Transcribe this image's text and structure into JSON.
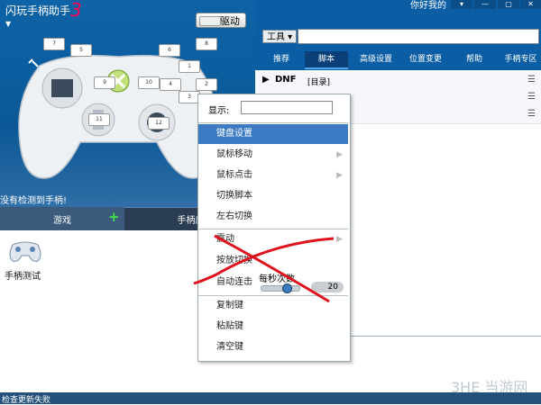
{
  "app": {
    "title": "闪玩手柄助手",
    "user": "你好我的",
    "driver_label": "驱动",
    "status_line": "没有检测到手柄!",
    "bottom_status": "检查更新失败"
  },
  "window_controls": [
    "▾",
    "—",
    "▢",
    "✕"
  ],
  "toolbar": {
    "tool_label": "工具"
  },
  "nav_tabs": [
    "推荐",
    "脚本",
    "高级设置",
    "位置变更",
    "帮助",
    "手柄专区"
  ],
  "active_tab": 1,
  "controller_buttons": [
    "7",
    "5",
    "6",
    "8",
    "1",
    "9",
    "10",
    "4",
    "2",
    "3",
    "11",
    "12"
  ],
  "left_tabs": {
    "games": "游戏",
    "apps": "手柄应"
  },
  "games": [
    {
      "label": "手柄测试",
      "icon": "gamepad-icon"
    }
  ],
  "scripts": [
    {
      "name": "DNF",
      "tag": "[目录]"
    },
    {
      "name": "",
      "tag": ""
    },
    {
      "name": "",
      "tag": ""
    }
  ],
  "context_menu": {
    "display_label": "显示:",
    "items": [
      {
        "label": "键盘设置",
        "submenu": false,
        "selected": true
      },
      {
        "label": "鼠标移动",
        "submenu": true
      },
      {
        "label": "鼠标点击",
        "submenu": true
      },
      {
        "label": "切换脚本",
        "submenu": false
      },
      {
        "label": "左右切换",
        "submenu": false
      },
      {
        "label": "震动",
        "submenu": true
      },
      {
        "label": "按放切换",
        "submenu": false
      },
      {
        "label": "自动连击",
        "submenu": false
      },
      {
        "label": "复制键",
        "submenu": false
      },
      {
        "label": "粘贴键",
        "submenu": false
      },
      {
        "label": "清空键",
        "submenu": false
      }
    ],
    "rate_label": "每秒次数",
    "rate_value": "20"
  },
  "watermark": "3HE 当游网",
  "colors": {
    "accent": "#3c7bc4",
    "header": "#0c5ea4",
    "cross": "#e0121e"
  }
}
